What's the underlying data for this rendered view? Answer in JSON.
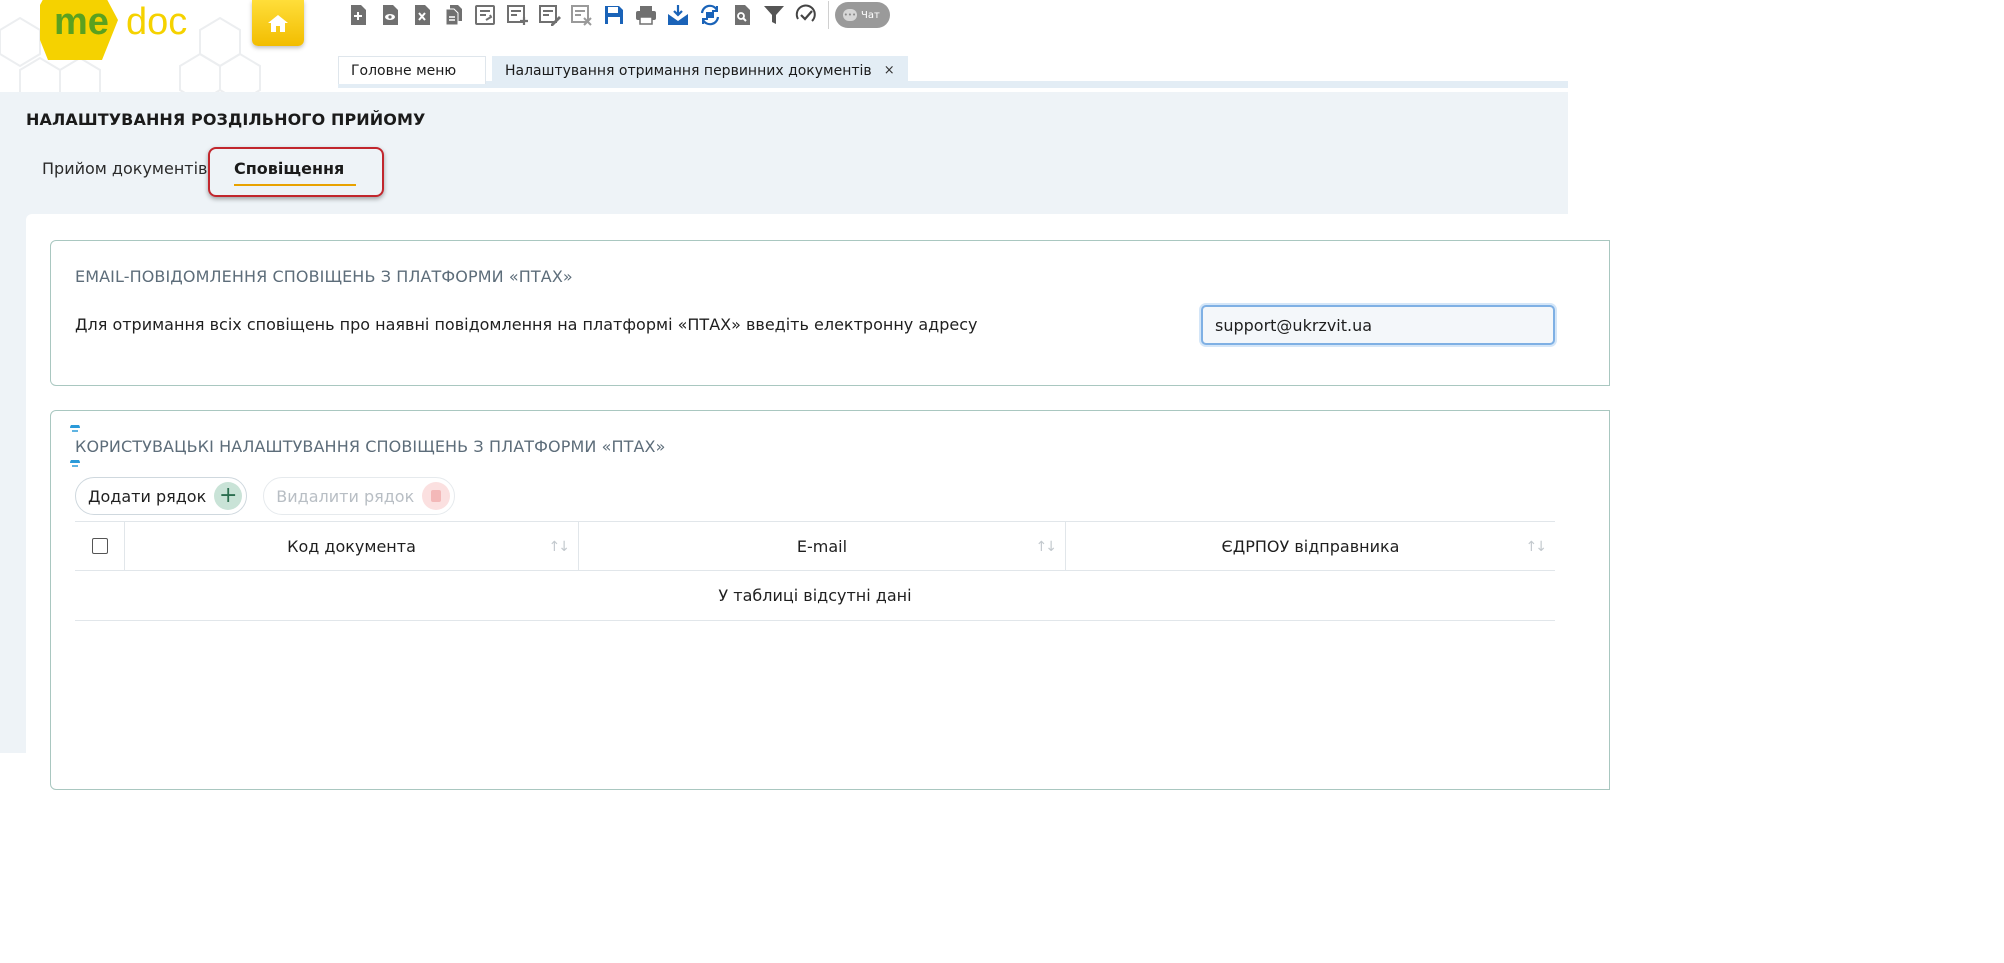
{
  "brand": {
    "logo_left": "me",
    "logo_right": "doc",
    "brand_yellow": "#f5d200",
    "brand_green": "#5aa11f"
  },
  "toolbar": {
    "icons": [
      "new-document-icon",
      "view-icon",
      "delete-icon",
      "copy-icon",
      "send-icon",
      "add-row-icon",
      "edit-icon",
      "remove-row-icon",
      "save-icon",
      "print-icon",
      "receive-icon",
      "sync-icon",
      "search-icon",
      "filter-icon",
      "check-icon"
    ],
    "chat_label": "Чат"
  },
  "window_tabs": [
    {
      "label": "Головне меню",
      "active": false
    },
    {
      "label": "Налаштування отримання первинних документів",
      "active": true,
      "close": "×"
    }
  ],
  "page": {
    "title": "НАЛАШТУВАННЯ РОЗДІЛЬНОГО ПРИЙОМУ",
    "sub_tabs": [
      {
        "label": "Прийом документів",
        "active": false
      },
      {
        "label": "Сповіщення",
        "active": true
      }
    ],
    "highlight_color": "#c1262d",
    "active_tab_underline": "#e8a200"
  },
  "email_section": {
    "title": "EMAIL-ПОВІДОМЛЕННЯ СПОВІЩЕНЬ З ПЛАТФОРМИ «ПТАХ»",
    "description": "Для отримання всіх сповіщень про наявні повідомлення на платформі «ПТАХ» введіть електронну адресу",
    "email_value": "support@ukrzvit.ua"
  },
  "user_section": {
    "title": "КОРИСТУВАЦЬКІ НАЛАШТУВАННЯ СПОВІЩЕНЬ З ПЛАТФОРМИ «ПТАХ»",
    "add_row_label": "Додати рядок",
    "delete_row_label": "Видалити рядок",
    "columns": [
      "Код документа",
      "E-mail",
      "ЄДРПОУ відправника"
    ],
    "empty_message": "У таблиці відсутні дані"
  }
}
